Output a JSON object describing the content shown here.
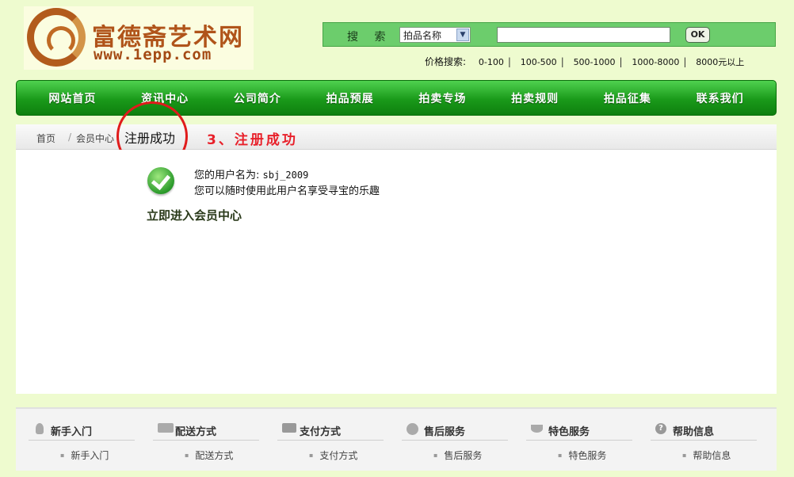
{
  "header": {
    "logo_title": "富德斋艺术网",
    "logo_url": "www.1epp.com",
    "search": {
      "label": "搜 索",
      "select_value": "拍品名称",
      "input_value": "",
      "ok_label": "OK"
    },
    "price_search": {
      "label": "价格搜索:",
      "items": [
        "0-100",
        "100-500",
        "500-1000",
        "1000-8000",
        "8000元以上"
      ]
    }
  },
  "nav": {
    "items": [
      "网站首页",
      "资讯中心",
      "公司简介",
      "拍品预展",
      "拍卖专场",
      "拍卖规则",
      "拍品征集",
      "联系我们"
    ]
  },
  "breadcrumb": {
    "home": "首页",
    "separator": "/",
    "member": "会员中心",
    "current": "注册成功"
  },
  "annotation": {
    "step_note": "3、注册成功"
  },
  "content": {
    "username_label": "您的用户名为:",
    "username_value": "sbj_2009",
    "hint": "您可以随时使用此用户名享受寻宝的乐趣",
    "enter_member": "立即进入会员中心"
  },
  "footer": {
    "columns": [
      {
        "title": "新手入门",
        "item": "新手入门",
        "icon": "bulb-icon"
      },
      {
        "title": "配送方式",
        "item": "配送方式",
        "icon": "truck-icon"
      },
      {
        "title": "支付方式",
        "item": "支付方式",
        "icon": "card-icon"
      },
      {
        "title": "售后服务",
        "item": "售后服务",
        "icon": "globe-icon"
      },
      {
        "title": "特色服务",
        "item": "特色服务",
        "icon": "leaf-icon"
      },
      {
        "title": "帮助信息",
        "item": "帮助信息",
        "icon": "help-icon"
      }
    ]
  },
  "colors": {
    "page_bg": "#eefbcf",
    "nav_green": "#1a9a1a",
    "annotation_red": "#e8202a"
  }
}
